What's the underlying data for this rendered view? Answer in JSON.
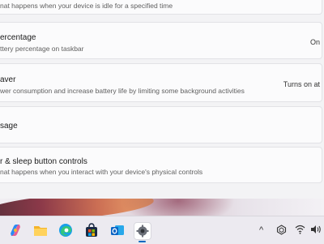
{
  "settings": {
    "items": [
      {
        "title": "",
        "desc": "nat happens when your device is idle for a specified time",
        "value": ""
      },
      {
        "title": "ercentage",
        "desc": "ttery percentage on taskbar",
        "value": "On"
      },
      {
        "title": "aver",
        "desc": "wer consumption and increase battery life by limiting some background activities",
        "value": "Turns on at"
      },
      {
        "title": "sage",
        "desc": "",
        "value": ""
      },
      {
        "title": "r & sleep button controls",
        "desc": "nat happens when you interact with your device's physical controls",
        "value": ""
      }
    ]
  },
  "taskbar": {
    "icons": [
      "copilot-icon",
      "file-explorer-icon",
      "edge-icon",
      "microsoft-store-icon",
      "outlook-icon",
      "settings-icon"
    ],
    "tray": {
      "chevron": "^",
      "icons": [
        "network-icon",
        "wifi-icon",
        "volume-icon"
      ]
    }
  },
  "colors": {
    "card_bg": "#fbfbfc",
    "window_bg": "#f3f3f5",
    "taskbar_bg": "#eceaf0",
    "accent": "#0067c0"
  }
}
